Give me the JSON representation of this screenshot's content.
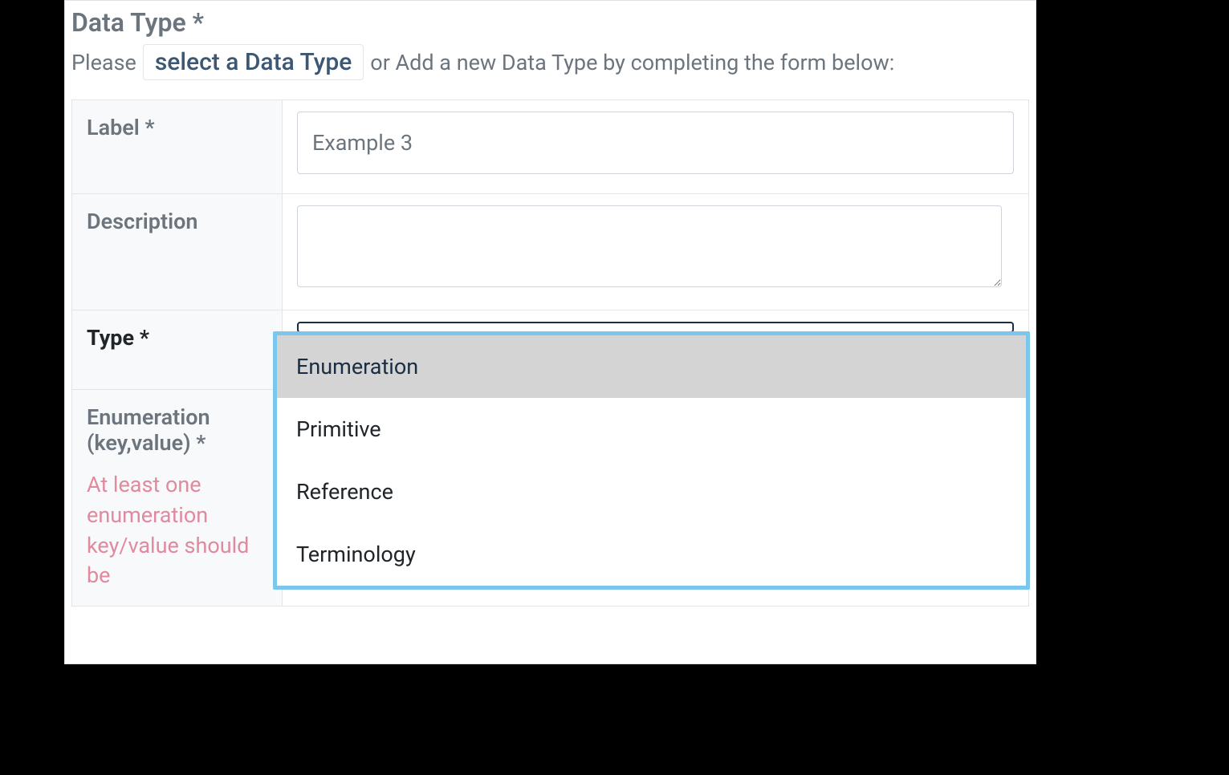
{
  "header": {
    "title": "Data Type *",
    "instructionPre": "Please",
    "linkLabel": "select a Data Type",
    "instructionPost": "or Add a new Data Type by completing the form below:"
  },
  "form": {
    "label": {
      "text": "Label *",
      "value": "Example 3"
    },
    "description": {
      "text": "Description",
      "value": ""
    },
    "type": {
      "text": "Type *",
      "options": [
        "Enumeration",
        "Primitive",
        "Reference",
        "Terminology"
      ],
      "highlightedIndex": 0
    },
    "enumeration": {
      "text": "Enumeration (key,value) *",
      "hint": "At least one enumeration key/value should be"
    }
  }
}
